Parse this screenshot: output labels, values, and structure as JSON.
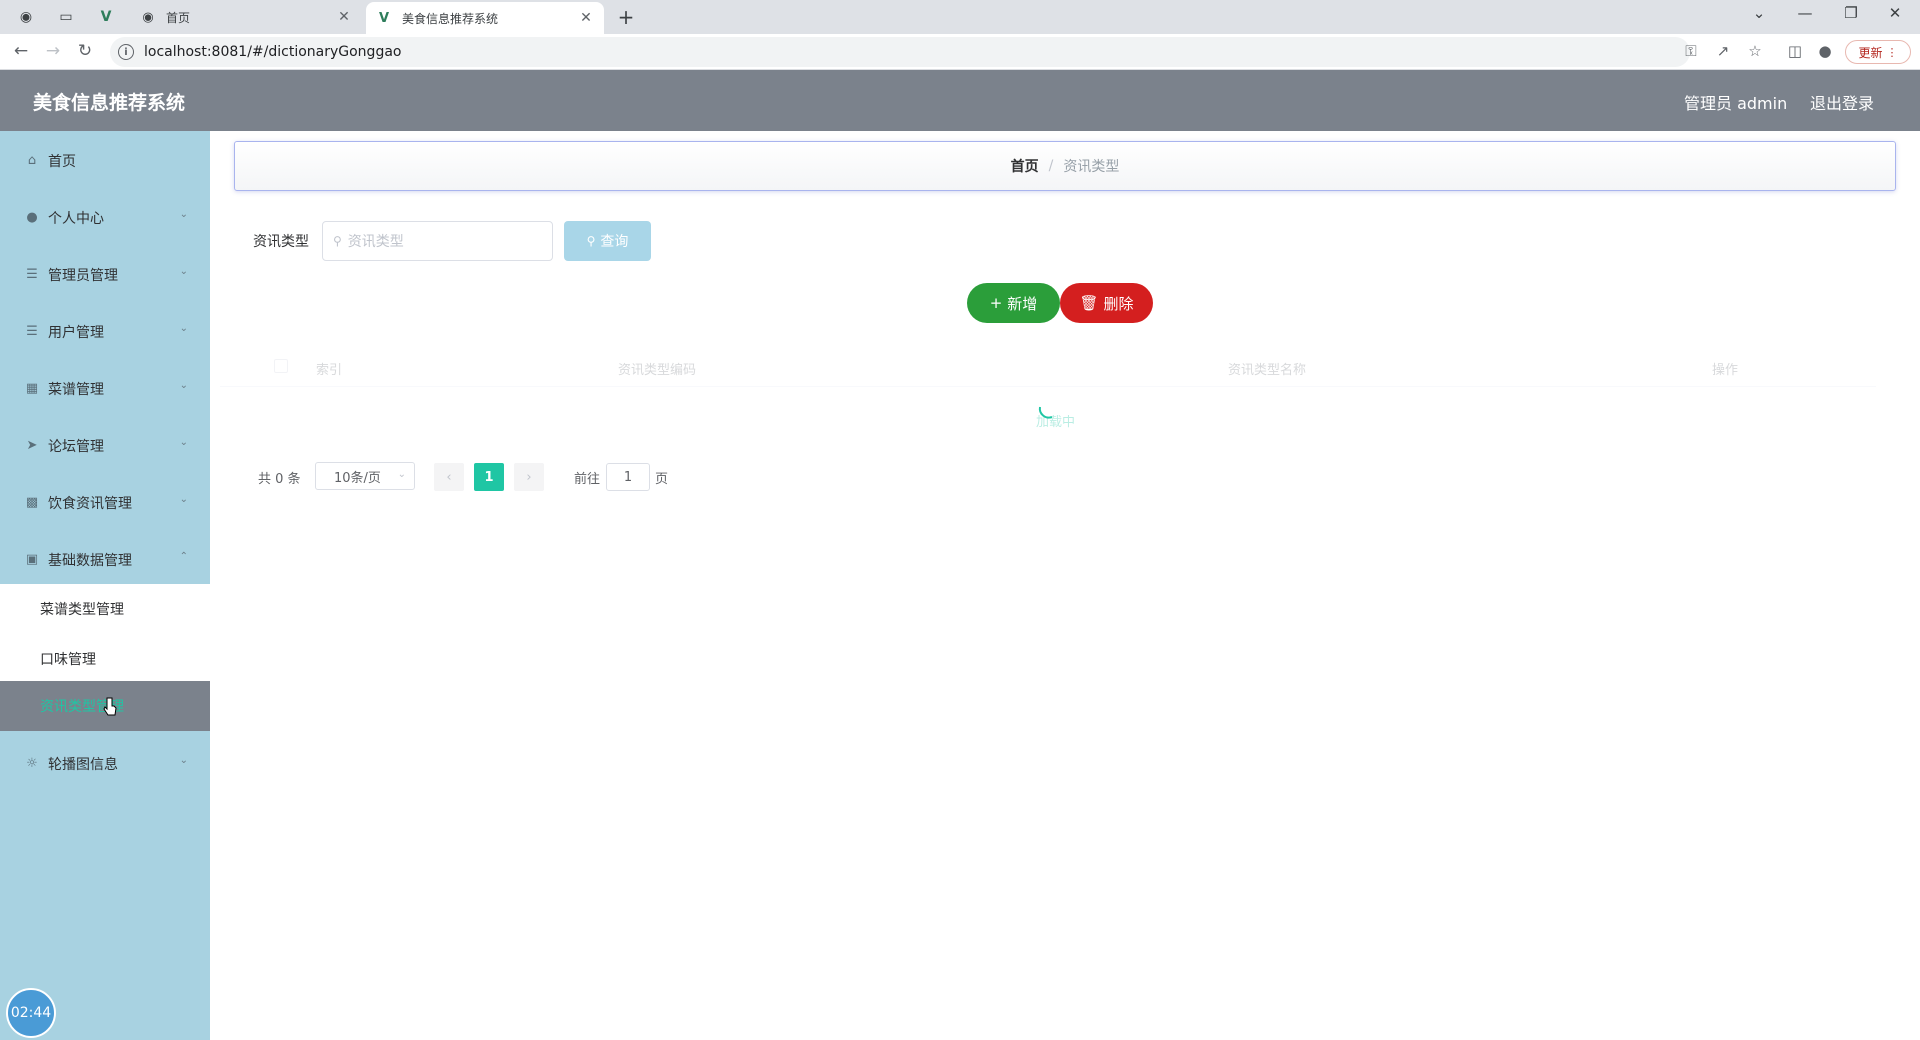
{
  "browser": {
    "tabs": [
      {
        "title": "首页",
        "active": false
      },
      {
        "title": "美食信息推荐系统",
        "active": true
      }
    ],
    "new_tab_symbol": "+",
    "url": "localhost:8081/#/dictionaryGonggao",
    "update_label": "更新"
  },
  "header": {
    "app_title": "美食信息推荐系统",
    "admin_label": "管理员 admin",
    "logout_label": "退出登录"
  },
  "sidebar": {
    "items": [
      {
        "label": "首页",
        "icon": "home-icon"
      },
      {
        "label": "个人中心",
        "icon": "user-icon"
      },
      {
        "label": "管理员管理",
        "icon": "menu-icon"
      },
      {
        "label": "用户管理",
        "icon": "menu-icon"
      },
      {
        "label": "菜谱管理",
        "icon": "chart-icon"
      },
      {
        "label": "论坛管理",
        "icon": "send-icon"
      },
      {
        "label": "饮食资讯管理",
        "icon": "briefcase-icon"
      },
      {
        "label": "基础数据管理",
        "icon": "box-icon"
      },
      {
        "label": "轮播图信息",
        "icon": "compass-icon"
      }
    ],
    "submenu": [
      {
        "label": "菜谱类型管理"
      },
      {
        "label": "口味管理"
      },
      {
        "label": "资讯类型管理"
      }
    ],
    "clock": "02:44"
  },
  "breadcrumb": {
    "home": "首页",
    "separator": "/",
    "current": "资讯类型"
  },
  "search": {
    "label": "资讯类型",
    "placeholder": "资讯类型",
    "query_label": "查询"
  },
  "actions": {
    "add_label": "新增",
    "delete_label": "删除"
  },
  "table": {
    "columns": [
      "索引",
      "资讯类型编码",
      "资讯类型名称",
      "操作"
    ],
    "loading_text": "加载中"
  },
  "pagination": {
    "total": "共 0 条",
    "page_size": "10条/页",
    "current_page": "1",
    "goto_label": "前往",
    "goto_value": "1",
    "goto_unit": "页"
  }
}
